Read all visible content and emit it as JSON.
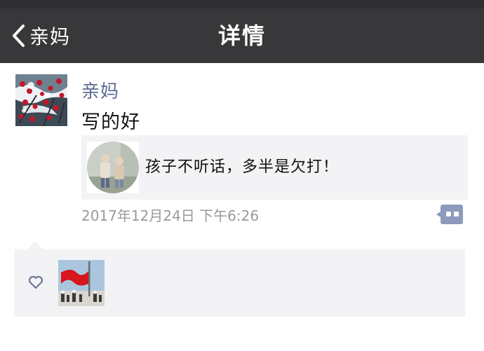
{
  "nav": {
    "back_label": "亲妈",
    "title": "详情"
  },
  "post": {
    "author": "亲妈",
    "text": "写的好",
    "link": {
      "title": "孩子不听话，多半是欠打！"
    },
    "timestamp": "2017年12月24日 下午6:26"
  },
  "icons": {
    "back": "chevron-left-icon",
    "comment": "comment-dots-icon",
    "like": "heart-outline-icon"
  },
  "colors": {
    "nav_bg": "#38383a",
    "author_blue": "#5b6a92",
    "panel_bg": "#f3f3f5",
    "timestamp_gray": "#9a9a9a",
    "comment_btn": "#8c9abb"
  }
}
